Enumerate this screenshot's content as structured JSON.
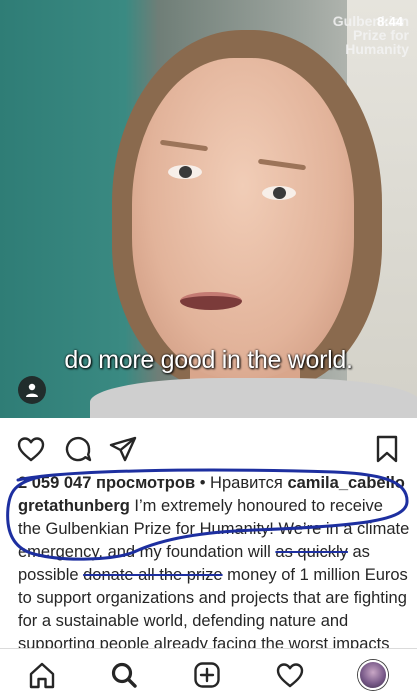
{
  "video": {
    "brand_line1": "Gulbenkian",
    "brand_line2": "Prize for",
    "brand_line3": "Humanity",
    "clock": "8:44",
    "subtitle": "do more good in the world."
  },
  "post": {
    "views": "2 059 047 просмотров",
    "liked_by_prefix": " • Нравится ",
    "liked_by_user": "camila_cabello",
    "author": "gretathunberg",
    "caption_part1": " I’m extremely honoured to receive the Gulbenkian Prize for Humanity! We’re in a climate emergency, and my foundation will ",
    "caption_strike1": "as quickly",
    "caption_part2": " as possible ",
    "caption_strike2": "donate all the prize",
    "caption_part3": " money of 1 million Euros to support organizations and projects that are fighting for a sustainable world, defending nature and supporting people already facing the worst impacts"
  },
  "colors": {
    "annotation_blue": "#1d2fa0",
    "text": "#262626"
  },
  "icons": {
    "like": "heart-icon",
    "comment": "comment-icon",
    "share": "send-icon",
    "save": "bookmark-icon",
    "home": "home-icon",
    "search": "search-icon",
    "add": "add-post-icon",
    "activity": "heart-icon",
    "profile": "avatar"
  }
}
